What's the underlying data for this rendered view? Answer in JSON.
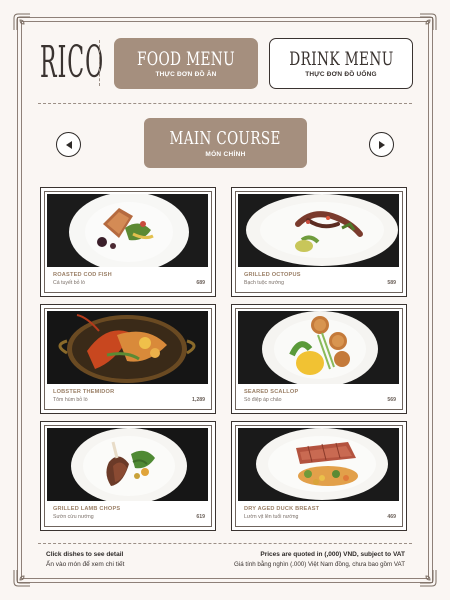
{
  "brand": {
    "logo_text": "RICO"
  },
  "tabs": [
    {
      "title": "FOOD MENU",
      "subtitle": "THỰC ĐƠN ĐỒ ĂN",
      "active": true
    },
    {
      "title": "DRINK MENU",
      "subtitle": "THỰC ĐƠN ĐỒ UỐNG",
      "active": false
    }
  ],
  "section": {
    "title": "MAIN COURSE",
    "subtitle": "MÓN CHÍNH"
  },
  "nav": {
    "prev_icon": "arrow-left-icon",
    "next_icon": "arrow-right-icon"
  },
  "dishes": [
    {
      "name": "ROASTED COD FISH",
      "subtitle": "Cá tuyết bỏ lò",
      "price": "689"
    },
    {
      "name": "GRILLED OCTOPUS",
      "subtitle": "Bạch tuộc nướng",
      "price": "589"
    },
    {
      "name": "LOBSTER THEMIDOR",
      "subtitle": "Tôm hùm bỏ lò",
      "price": "1,289"
    },
    {
      "name": "SEARED SCALLOP",
      "subtitle": "Sò điệp áp chảo",
      "price": "569"
    },
    {
      "name": "GRILLED LAMB CHOPS",
      "subtitle": "Sườn cừu nướng",
      "price": "619"
    },
    {
      "name": "DRY AGED DUCK BREAST",
      "subtitle": "Lườn vịt lên tuổi nướng",
      "price": "469"
    }
  ],
  "footer": {
    "hint_en": "Click dishes to see detail",
    "hint_vi": "Ấn vào món để xem chi tiết",
    "prices_en": "Prices are quoted in (,000) VND, subject to VAT",
    "prices_vi": "Giá tính bằng nghìn (.000) Việt Nam đồng, chưa bao gồm VAT"
  },
  "colors": {
    "accent": "#a58f7e",
    "background": "#faf6f3",
    "ink": "#3a3330",
    "dish_name": "#9a7f66"
  }
}
